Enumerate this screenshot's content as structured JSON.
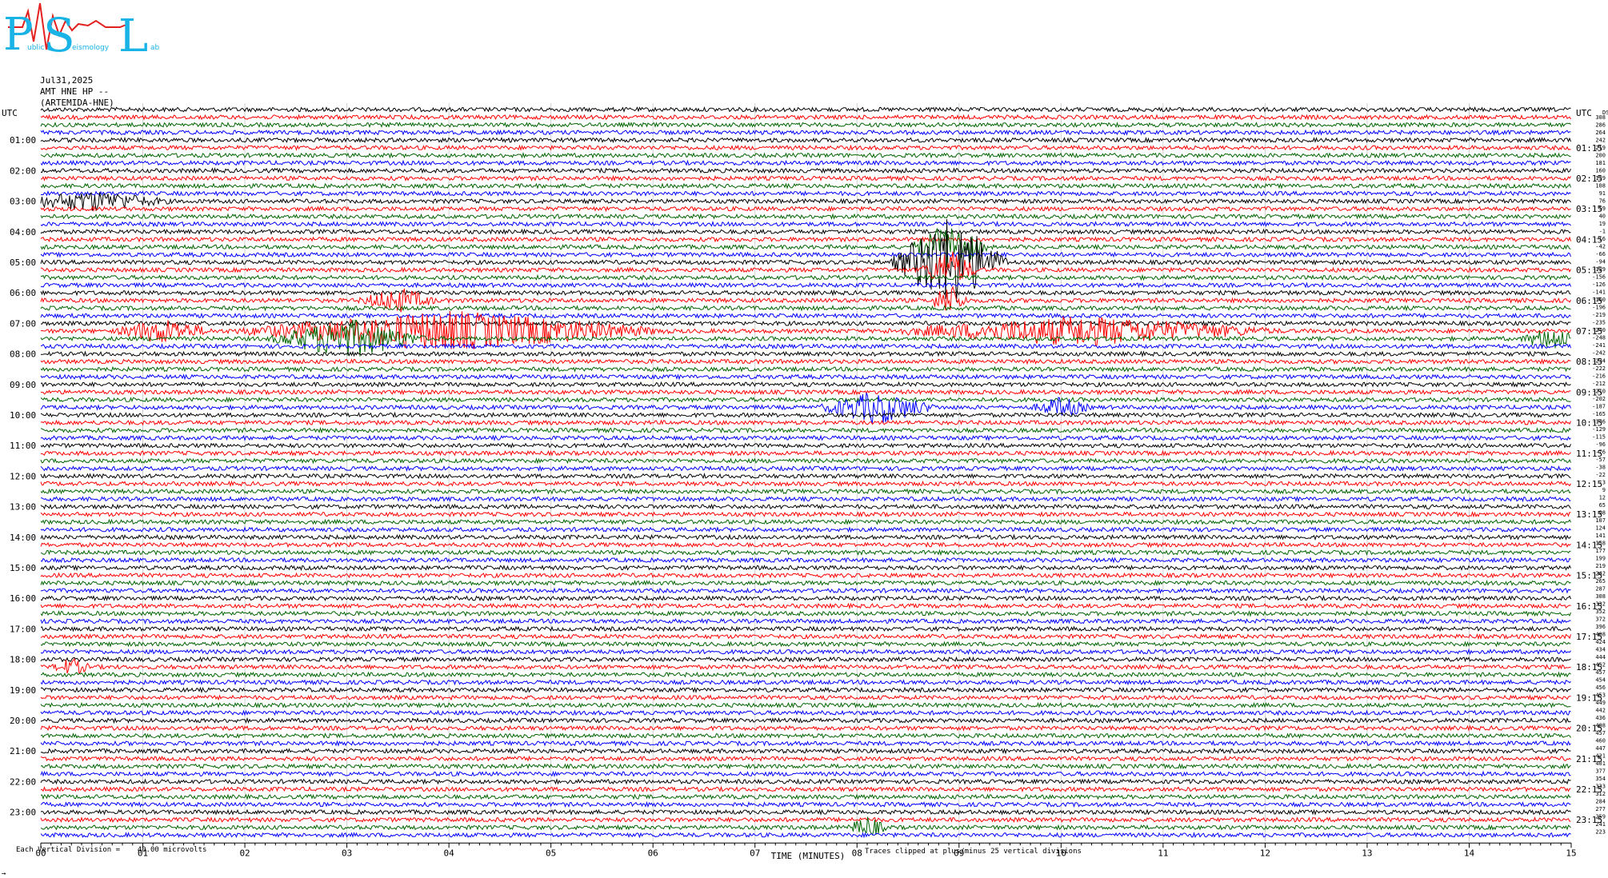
{
  "logo": {
    "letters": [
      "P",
      "S",
      "L"
    ],
    "small_texts": [
      "ublic",
      "eismology",
      "ab"
    ],
    "colors": {
      "cyan": "#19b3e6",
      "red": "#e41f1f"
    }
  },
  "header": {
    "date": "Jul31,2025",
    "station": "AMT HNE HP --",
    "channel": "(ARTEMIDA-HNE)"
  },
  "chart_data": {
    "type": "line",
    "utc_left_label": "UTC",
    "utc_right_label": "UTC",
    "ds_label": "DS",
    "left_hour_labels": [
      "01:00",
      "02:00",
      "03:00",
      "04:00",
      "05:00",
      "06:00",
      "07:00",
      "08:00",
      "09:00",
      "10:00",
      "11:00",
      "12:00",
      "13:00",
      "14:00",
      "15:00",
      "16:00",
      "17:00",
      "18:00",
      "19:00",
      "20:00",
      "21:00",
      "22:00",
      "23:00"
    ],
    "right_hour_labels": [
      "01:15",
      "02:15",
      "03:15",
      "04:15",
      "05:15",
      "06:15",
      "07:15",
      "08:15",
      "09:15",
      "10:15",
      "11:15",
      "12:15",
      "13:15",
      "14:15",
      "15:15",
      "16:15",
      "17:15",
      "18:15",
      "19:15",
      "20:15",
      "21:15",
      "22:15",
      "23:15"
    ],
    "x_ticks": [
      "00",
      "01",
      "02",
      "03",
      "04",
      "05",
      "06",
      "07",
      "08",
      "09",
      "10",
      "11",
      "12",
      "13",
      "14",
      "15"
    ],
    "xlabel": "TIME (MINUTES)",
    "xlim": [
      0,
      15
    ],
    "trace_count": 96,
    "trace_colors": [
      "#000000",
      "#ff0000",
      "#006400",
      "#0000ff"
    ],
    "ds_values": [
      "308",
      "286",
      "264",
      "242",
      "219",
      "200",
      "181",
      "160",
      "139",
      "108",
      "91",
      "76",
      "59",
      "40",
      "19",
      "-1",
      "-16",
      "-42",
      "-66",
      "-94",
      "-129",
      "-156",
      "-126",
      "-141",
      "-160",
      "-196",
      "-219",
      "-235",
      "-240",
      "-248",
      "-241",
      "-242",
      "-234",
      "-222",
      "-216",
      "-212",
      "-210",
      "-202",
      "-187",
      "-165",
      "-146",
      "-129",
      "-115",
      "-96",
      "-76",
      "-57",
      "-38",
      "-22",
      "-3",
      "9",
      "12",
      "65",
      "98",
      "107",
      "124",
      "141",
      "158",
      "177",
      "199",
      "219",
      "242",
      "265",
      "287",
      "308",
      "332",
      "352",
      "372",
      "396",
      "408",
      "424",
      "434",
      "444",
      "452",
      "457",
      "454",
      "456",
      "453",
      "449",
      "442",
      "436",
      "408",
      "457",
      "460",
      "447",
      "421",
      "401",
      "377",
      "354",
      "333",
      "312",
      "284",
      "277",
      "259",
      "241",
      "223"
    ],
    "events": [
      {
        "trace": 20,
        "minute": 8.9,
        "amp": 6,
        "width": 0.6,
        "note": "large spike"
      },
      {
        "trace": 18,
        "minute": 8.9,
        "amp": 3,
        "width": 0.4
      },
      {
        "trace": 21,
        "minute": 8.9,
        "amp": 2.5,
        "width": 0.3
      },
      {
        "trace": 25,
        "minute": 8.9,
        "amp": 2,
        "width": 0.2
      },
      {
        "trace": 29,
        "minute": 4.0,
        "amp": 2.5,
        "width": 2.2
      },
      {
        "trace": 30,
        "minute": 3.0,
        "amp": 2.5,
        "width": 0.8
      },
      {
        "trace": 29,
        "minute": 10.2,
        "amp": 1.8,
        "width": 2.0
      },
      {
        "trace": 29,
        "minute": 1.2,
        "amp": 1.5,
        "width": 0.5
      },
      {
        "trace": 39,
        "minute": 8.2,
        "amp": 2,
        "width": 0.6
      },
      {
        "trace": 39,
        "minute": 10.0,
        "amp": 1.2,
        "width": 0.3
      },
      {
        "trace": 12,
        "minute": 0.5,
        "amp": 1.2,
        "width": 0.8
      },
      {
        "trace": 25,
        "minute": 3.5,
        "amp": 1.5,
        "width": 0.4
      },
      {
        "trace": 30,
        "minute": 14.8,
        "amp": 1.5,
        "width": 0.3
      },
      {
        "trace": 73,
        "minute": 0.3,
        "amp": 1.0,
        "width": 0.2
      },
      {
        "trace": 94,
        "minute": 8.1,
        "amp": 1.3,
        "width": 0.2
      }
    ]
  },
  "footer": {
    "vertical_division": "Each Vertical Division =    40.00 microvolts",
    "clip_note": "Traces clipped at plus/minus 25 vertical divisions",
    "corner_mark": "→"
  }
}
